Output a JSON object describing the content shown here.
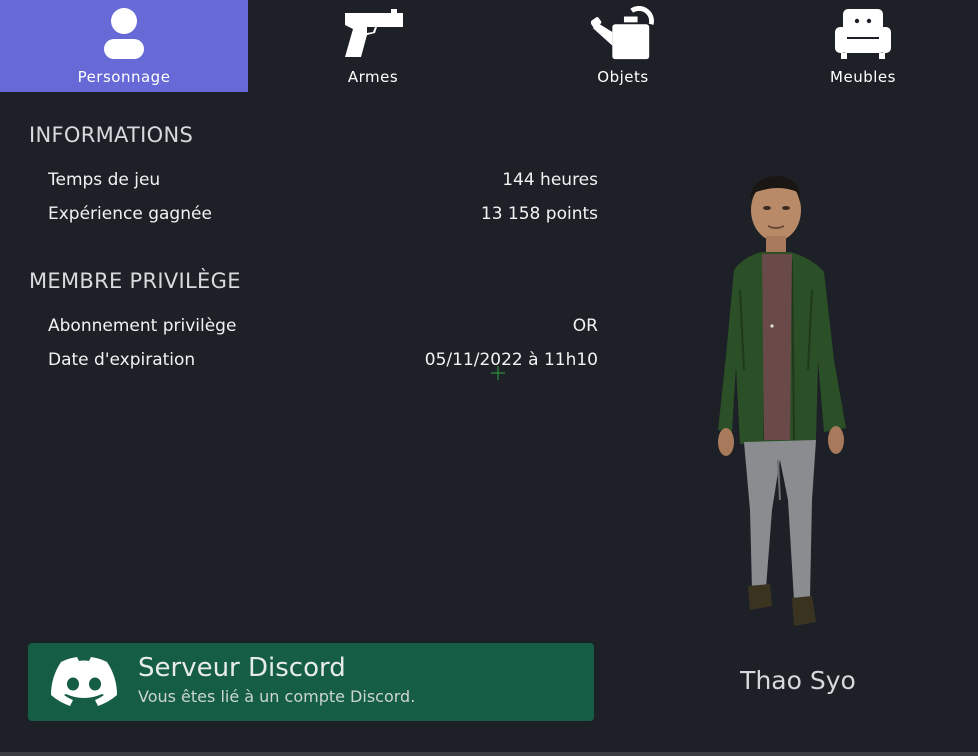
{
  "tabs": [
    {
      "label": "Personnage",
      "icon": "user-icon",
      "active": true
    },
    {
      "label": "Armes",
      "icon": "pistol-icon",
      "active": false
    },
    {
      "label": "Objets",
      "icon": "watering-can-icon",
      "active": false
    },
    {
      "label": "Meubles",
      "icon": "armchair-icon",
      "active": false
    }
  ],
  "informations": {
    "title": "INFORMATIONS",
    "rows": [
      {
        "label": "Temps de jeu",
        "value": "144 heures"
      },
      {
        "label": "Expérience gagnée",
        "value": "13 158 points"
      }
    ]
  },
  "privilege": {
    "title": "MEMBRE PRIVILÈGE",
    "rows": [
      {
        "label": "Abonnement privilège",
        "value": "OR"
      },
      {
        "label": "Date d'expiration",
        "value": "05/11/2022 à 11h10"
      }
    ]
  },
  "discord": {
    "title": "Serveur Discord",
    "subtitle": "Vous êtes lié à un compte Discord.",
    "icon": "discord-icon"
  },
  "character": {
    "name": "Thao Syo"
  },
  "colors": {
    "background": "#1d2026",
    "active_tab": "#6769d6",
    "discord_bg": "#155e45"
  }
}
